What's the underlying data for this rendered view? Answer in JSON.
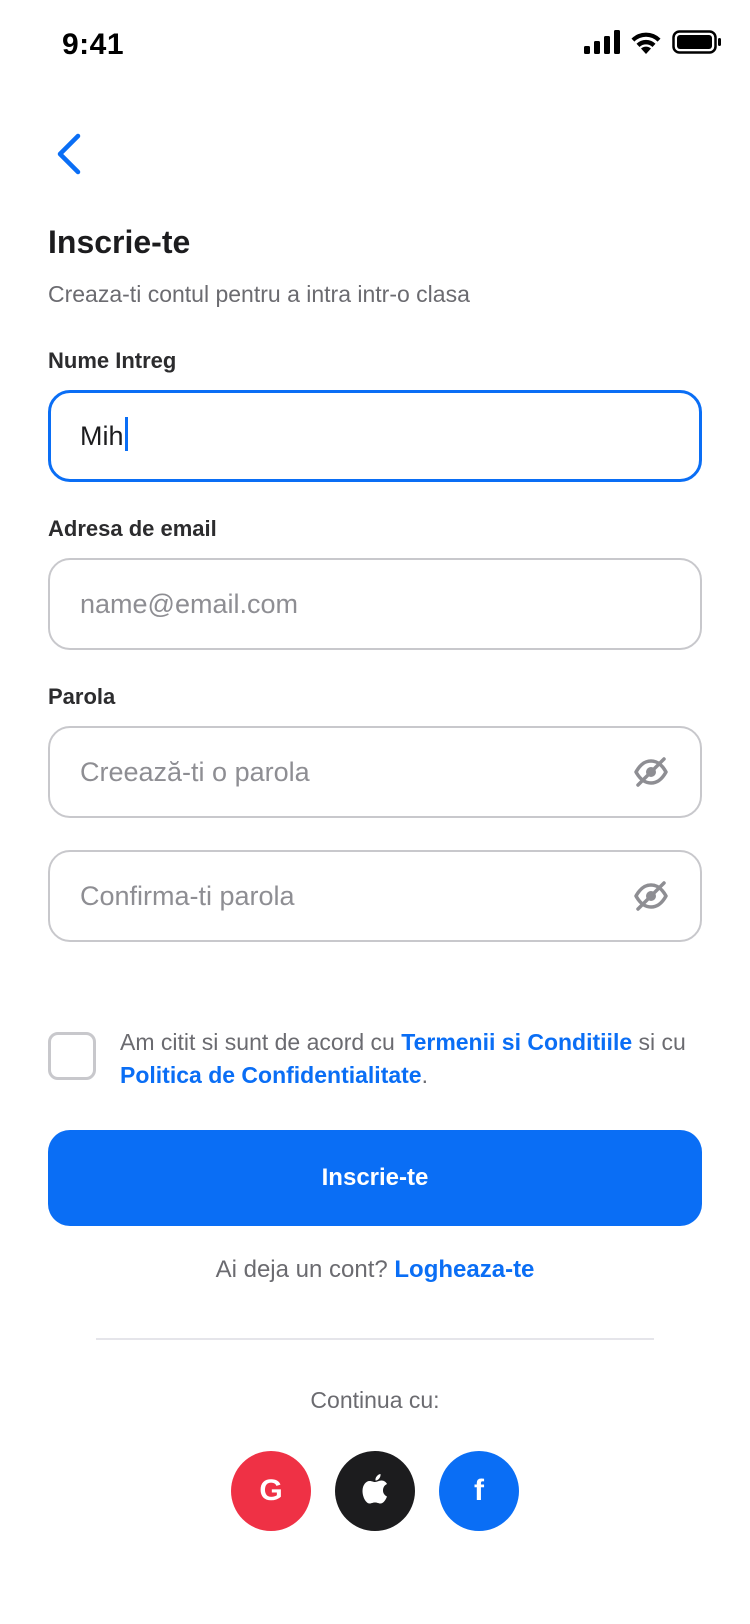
{
  "status_bar": {
    "time": "9:41",
    "icons": [
      "cellular-signal-icon",
      "wifi-icon",
      "battery-icon"
    ]
  },
  "header": {
    "back_icon": "chevron-left-icon",
    "title": "Inscrie-te",
    "subtitle": "Creaza-ti contul pentru a intra intr-o clasa"
  },
  "form": {
    "full_name": {
      "label": "Nume Intreg",
      "value": "Mih",
      "focused": true
    },
    "email": {
      "label": "Adresa de email",
      "value": "",
      "placeholder": "name@email.com"
    },
    "password": {
      "label": "Parola",
      "value": "",
      "placeholder": "Creează-ti o parola",
      "toggle_icon": "eye-off-icon"
    },
    "confirm_password": {
      "value": "",
      "placeholder": "Confirma-ti parola",
      "toggle_icon": "eye-off-icon"
    },
    "terms": {
      "checked": false,
      "text_part1": "Am citit si sunt de acord cu ",
      "terms_link": "Termenii si Conditiile",
      "text_part2": " si cu ",
      "privacy_link": "Politica de Confidentialitate",
      "text_part3": "."
    },
    "submit_label": "Inscrie-te"
  },
  "login_prompt": {
    "text": "Ai deja un cont? ",
    "link": "Logheaza-te"
  },
  "social": {
    "continue_text": "Continua cu:",
    "buttons": [
      {
        "name": "google",
        "glyph": "G",
        "icon": "google-icon",
        "color": "#ef3145"
      },
      {
        "name": "apple",
        "icon": "apple-icon",
        "color": "#1c1c1e"
      },
      {
        "name": "facebook",
        "glyph": "f",
        "icon": "facebook-icon",
        "color": "#0a6ef5"
      }
    ]
  },
  "colors": {
    "accent": "#0a6ef5",
    "border": "#c8c8cc",
    "muted_text": "#6b6b70",
    "placeholder": "#8e8e93"
  }
}
